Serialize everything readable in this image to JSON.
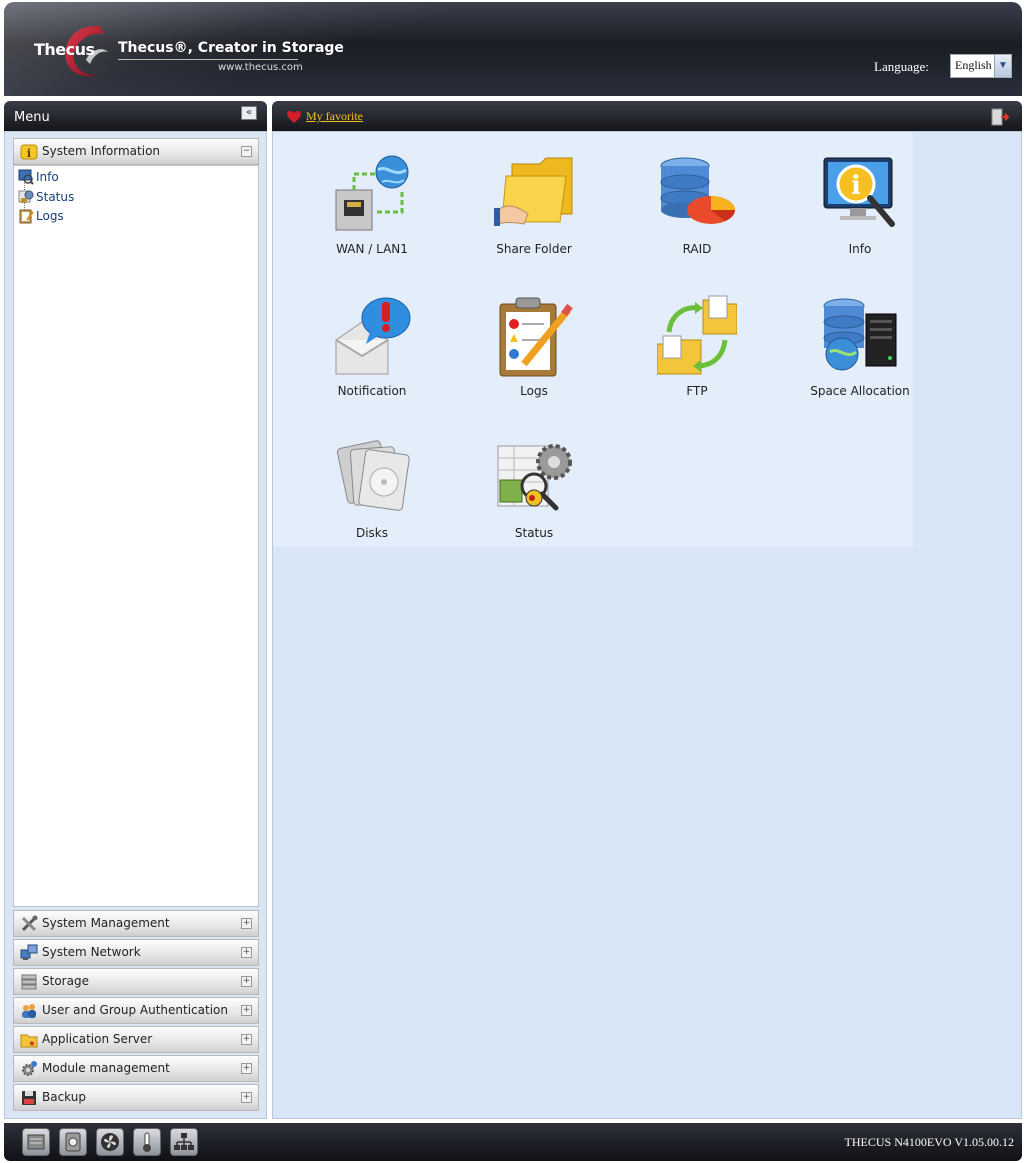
{
  "header": {
    "logo_text": "Thecus",
    "tagline": "Thecus®, Creator in Storage",
    "website": "www.thecus.com",
    "language_label": "Language:",
    "language_value": "English"
  },
  "menu": {
    "title": "Menu",
    "collapse": "«",
    "open_section": {
      "label": "System Information",
      "toggle": "−",
      "items": [
        {
          "label": "Info"
        },
        {
          "label": "Status"
        },
        {
          "label": "Logs"
        }
      ]
    },
    "sections": [
      {
        "label": "System Management",
        "toggle": "+"
      },
      {
        "label": "System Network",
        "toggle": "+"
      },
      {
        "label": "Storage",
        "toggle": "+"
      },
      {
        "label": "User and Group Authentication",
        "toggle": "+"
      },
      {
        "label": "Application Server",
        "toggle": "+"
      },
      {
        "label": "Module management",
        "toggle": "+"
      },
      {
        "label": "Backup",
        "toggle": "+"
      }
    ]
  },
  "favorites": {
    "link_label": "My favorite",
    "apps": [
      {
        "label": "WAN / LAN1",
        "icon": "network-icon"
      },
      {
        "label": "Share Folder",
        "icon": "folder-icon"
      },
      {
        "label": "RAID",
        "icon": "raid-icon"
      },
      {
        "label": "Info",
        "icon": "info-monitor-icon"
      },
      {
        "label": "Notification",
        "icon": "notification-icon"
      },
      {
        "label": "Logs",
        "icon": "clipboard-icon"
      },
      {
        "label": "FTP",
        "icon": "ftp-icon"
      },
      {
        "label": "Space Allocation",
        "icon": "server-icon"
      },
      {
        "label": "Disks",
        "icon": "disks-icon"
      },
      {
        "label": "Status",
        "icon": "status-icon"
      }
    ]
  },
  "footer": {
    "version": "THECUS N4100EVO V1.05.00.12"
  }
}
